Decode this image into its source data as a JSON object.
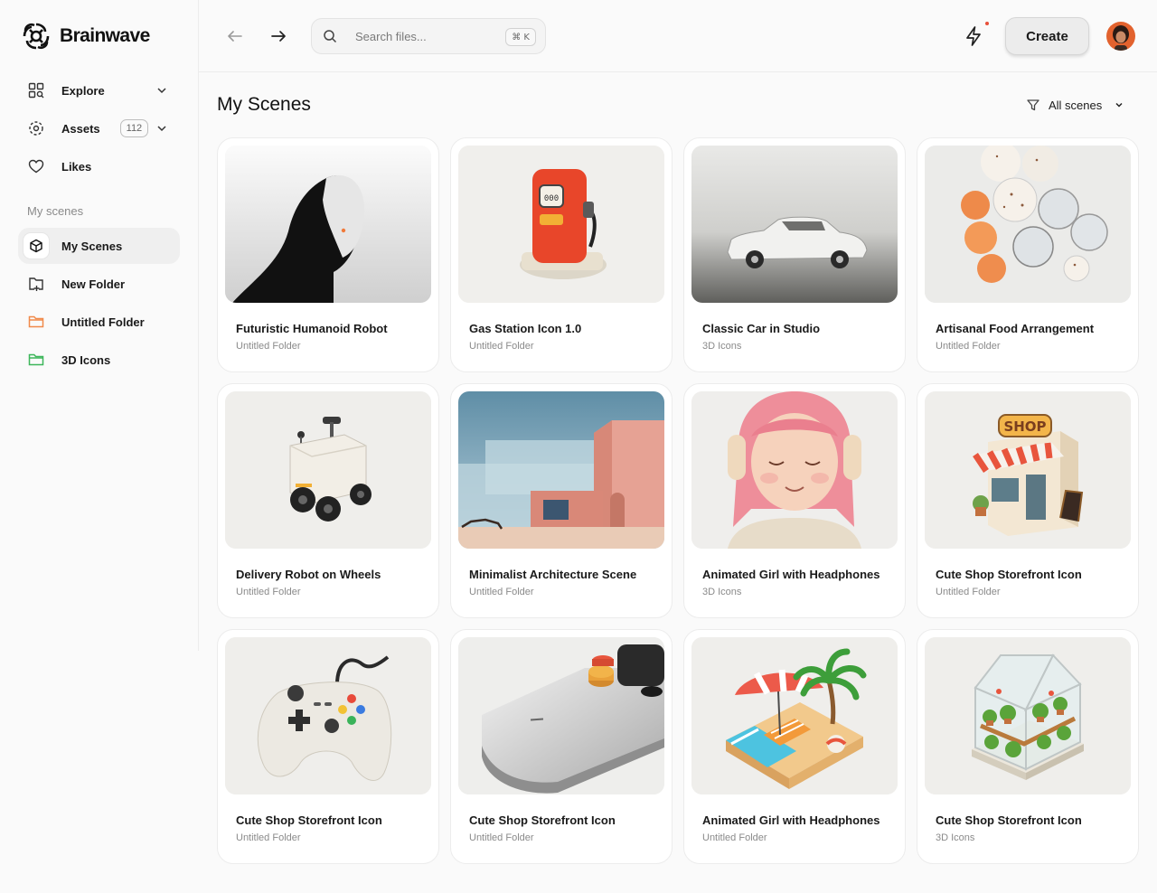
{
  "app": {
    "name": "Brainwave"
  },
  "sidebar": {
    "nav": [
      {
        "label": "Explore",
        "icon": "grid-search-icon"
      },
      {
        "label": "Assets",
        "icon": "assets-icon",
        "badge": "112"
      },
      {
        "label": "Likes",
        "icon": "heart-icon"
      }
    ],
    "section_label": "My scenes",
    "folders": [
      {
        "label": "My Scenes",
        "icon": "cube-icon",
        "active": true
      },
      {
        "label": "New Folder",
        "icon": "folder-plus-icon"
      },
      {
        "label": "Untitled Folder",
        "icon": "folder-icon",
        "color": "#f08a4b"
      },
      {
        "label": "3D Icons",
        "icon": "folder-icon",
        "color": "#3db65a"
      }
    ]
  },
  "topbar": {
    "search_placeholder": "Search files...",
    "shortcut": "⌘ K",
    "create_label": "Create",
    "notification_dot_color": "#e8503a"
  },
  "main": {
    "title": "My Scenes",
    "filter_label": "All scenes",
    "cards": [
      {
        "title": "Futuristic Humanoid Robot",
        "folder": "Untitled Folder"
      },
      {
        "title": "Gas Station Icon 1.0",
        "folder": "Untitled Folder"
      },
      {
        "title": "Classic Car in Studio",
        "folder": "3D Icons"
      },
      {
        "title": "Artisanal Food Arrangement",
        "folder": "Untitled Folder"
      },
      {
        "title": "Delivery Robot on Wheels",
        "folder": "Untitled Folder"
      },
      {
        "title": "Minimalist Architecture Scene",
        "folder": "Untitled Folder"
      },
      {
        "title": "Animated Girl with Headphones",
        "folder": "3D Icons"
      },
      {
        "title": "Cute Shop Storefront Icon",
        "folder": "Untitled Folder"
      },
      {
        "title": "Cute Shop Storefront Icon",
        "folder": "Untitled Folder"
      },
      {
        "title": "Cute Shop Storefront Icon",
        "folder": "Untitled Folder"
      },
      {
        "title": "Animated Girl with Headphones",
        "folder": "Untitled Folder"
      },
      {
        "title": "Cute Shop Storefront Icon",
        "folder": "3D Icons"
      }
    ]
  }
}
